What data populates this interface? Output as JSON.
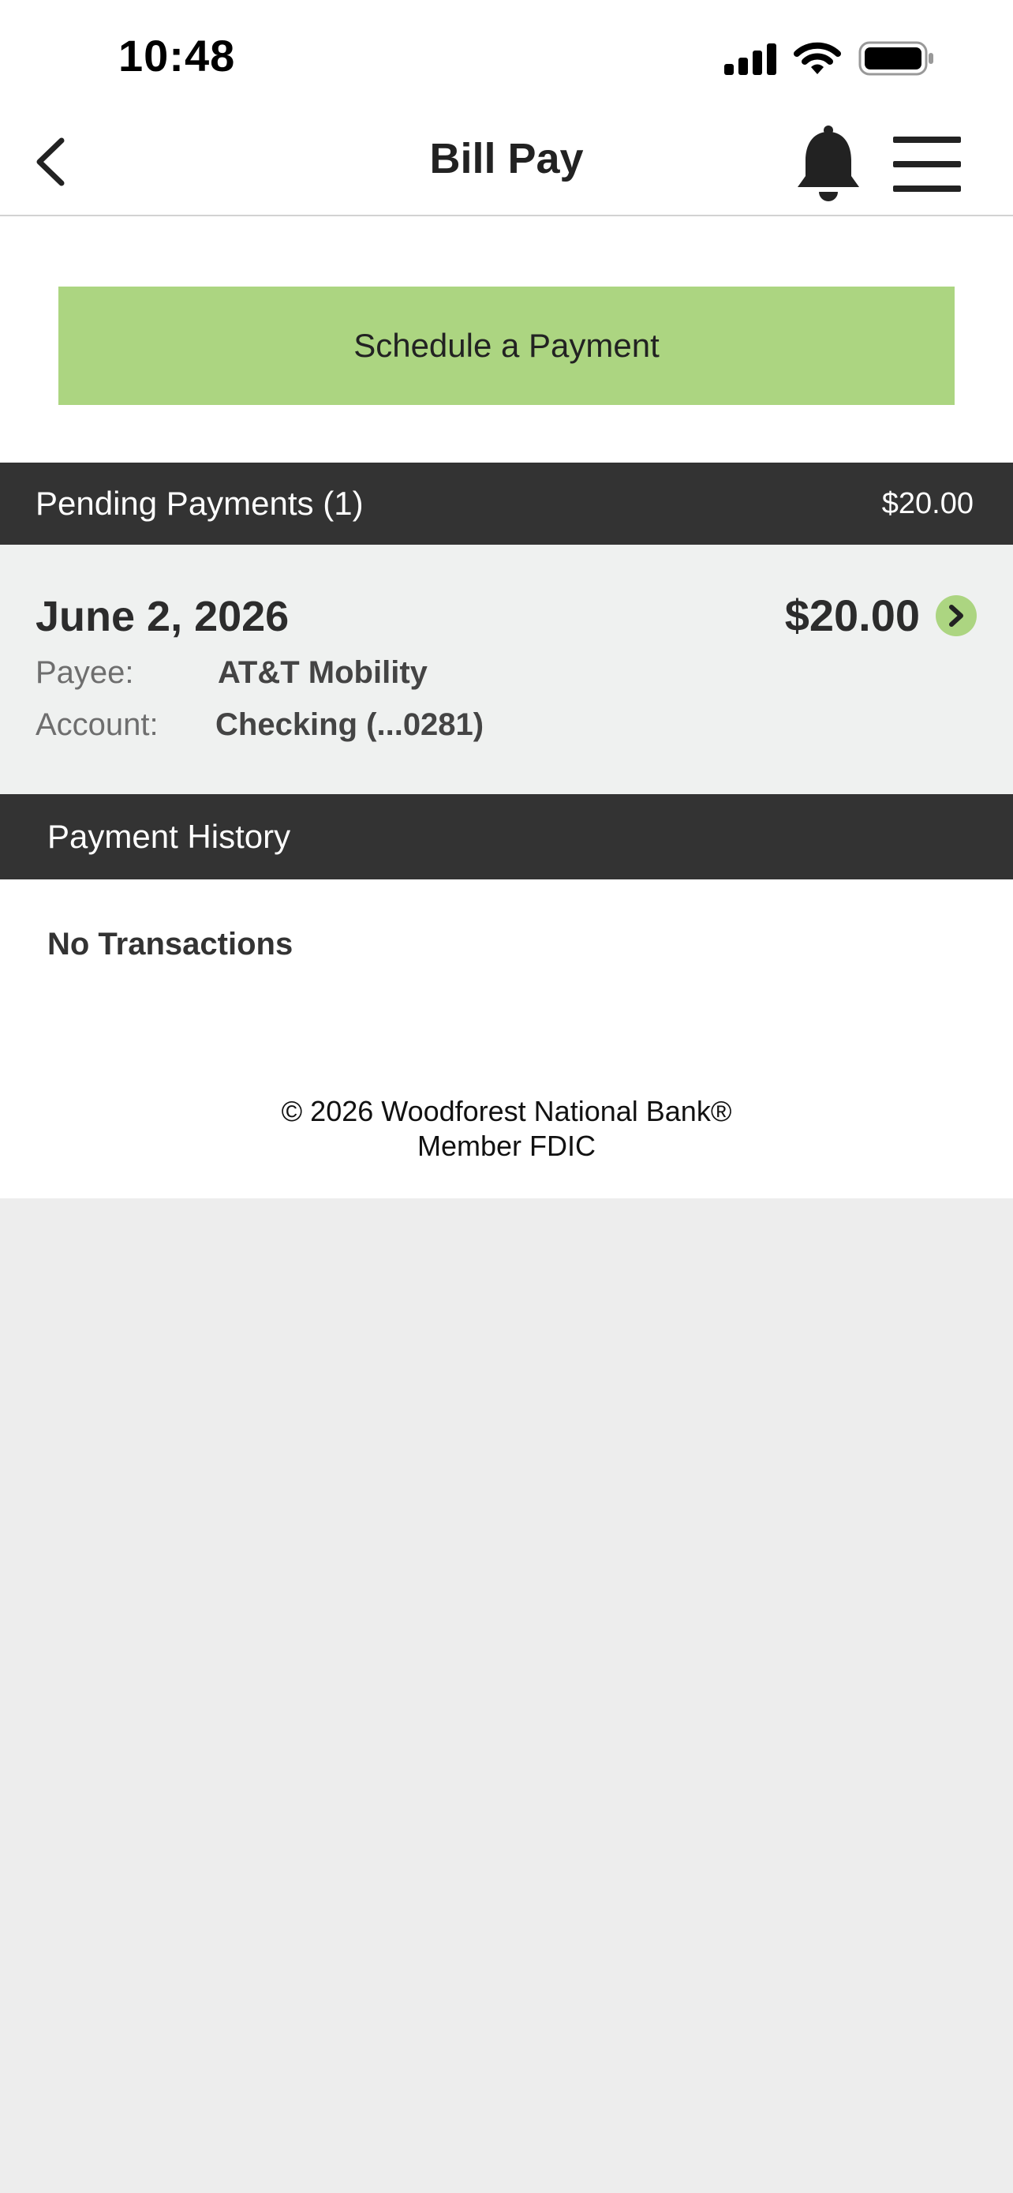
{
  "status_bar": {
    "time": "10:48",
    "icons": [
      "cellular-signal-icon",
      "wifi-icon",
      "battery-icon"
    ]
  },
  "header": {
    "title": "Bill Pay",
    "icons": [
      "chevron-left-icon",
      "bell-icon",
      "hamburger-menu-icon"
    ]
  },
  "actions": {
    "schedule_label": "Schedule a Payment"
  },
  "pending": {
    "title": "Pending Payments (1)",
    "total": "$20.00",
    "items": [
      {
        "date": "June 2, 2026",
        "amount": "$20.00",
        "payee_label": "Payee:",
        "payee": "AT&T Mobility",
        "account_label": "Account:",
        "account": "Checking (...0281)"
      }
    ]
  },
  "history": {
    "title": "Payment History",
    "empty_text": "No Transactions"
  },
  "footer": {
    "copyright": "© 2026 Woodforest National Bank®",
    "member": "Member FDIC"
  },
  "colors": {
    "accent_green": "#acd581",
    "section_bar": "#333333",
    "card_bg": "#eff1f0",
    "page_bg": "#ededed"
  }
}
